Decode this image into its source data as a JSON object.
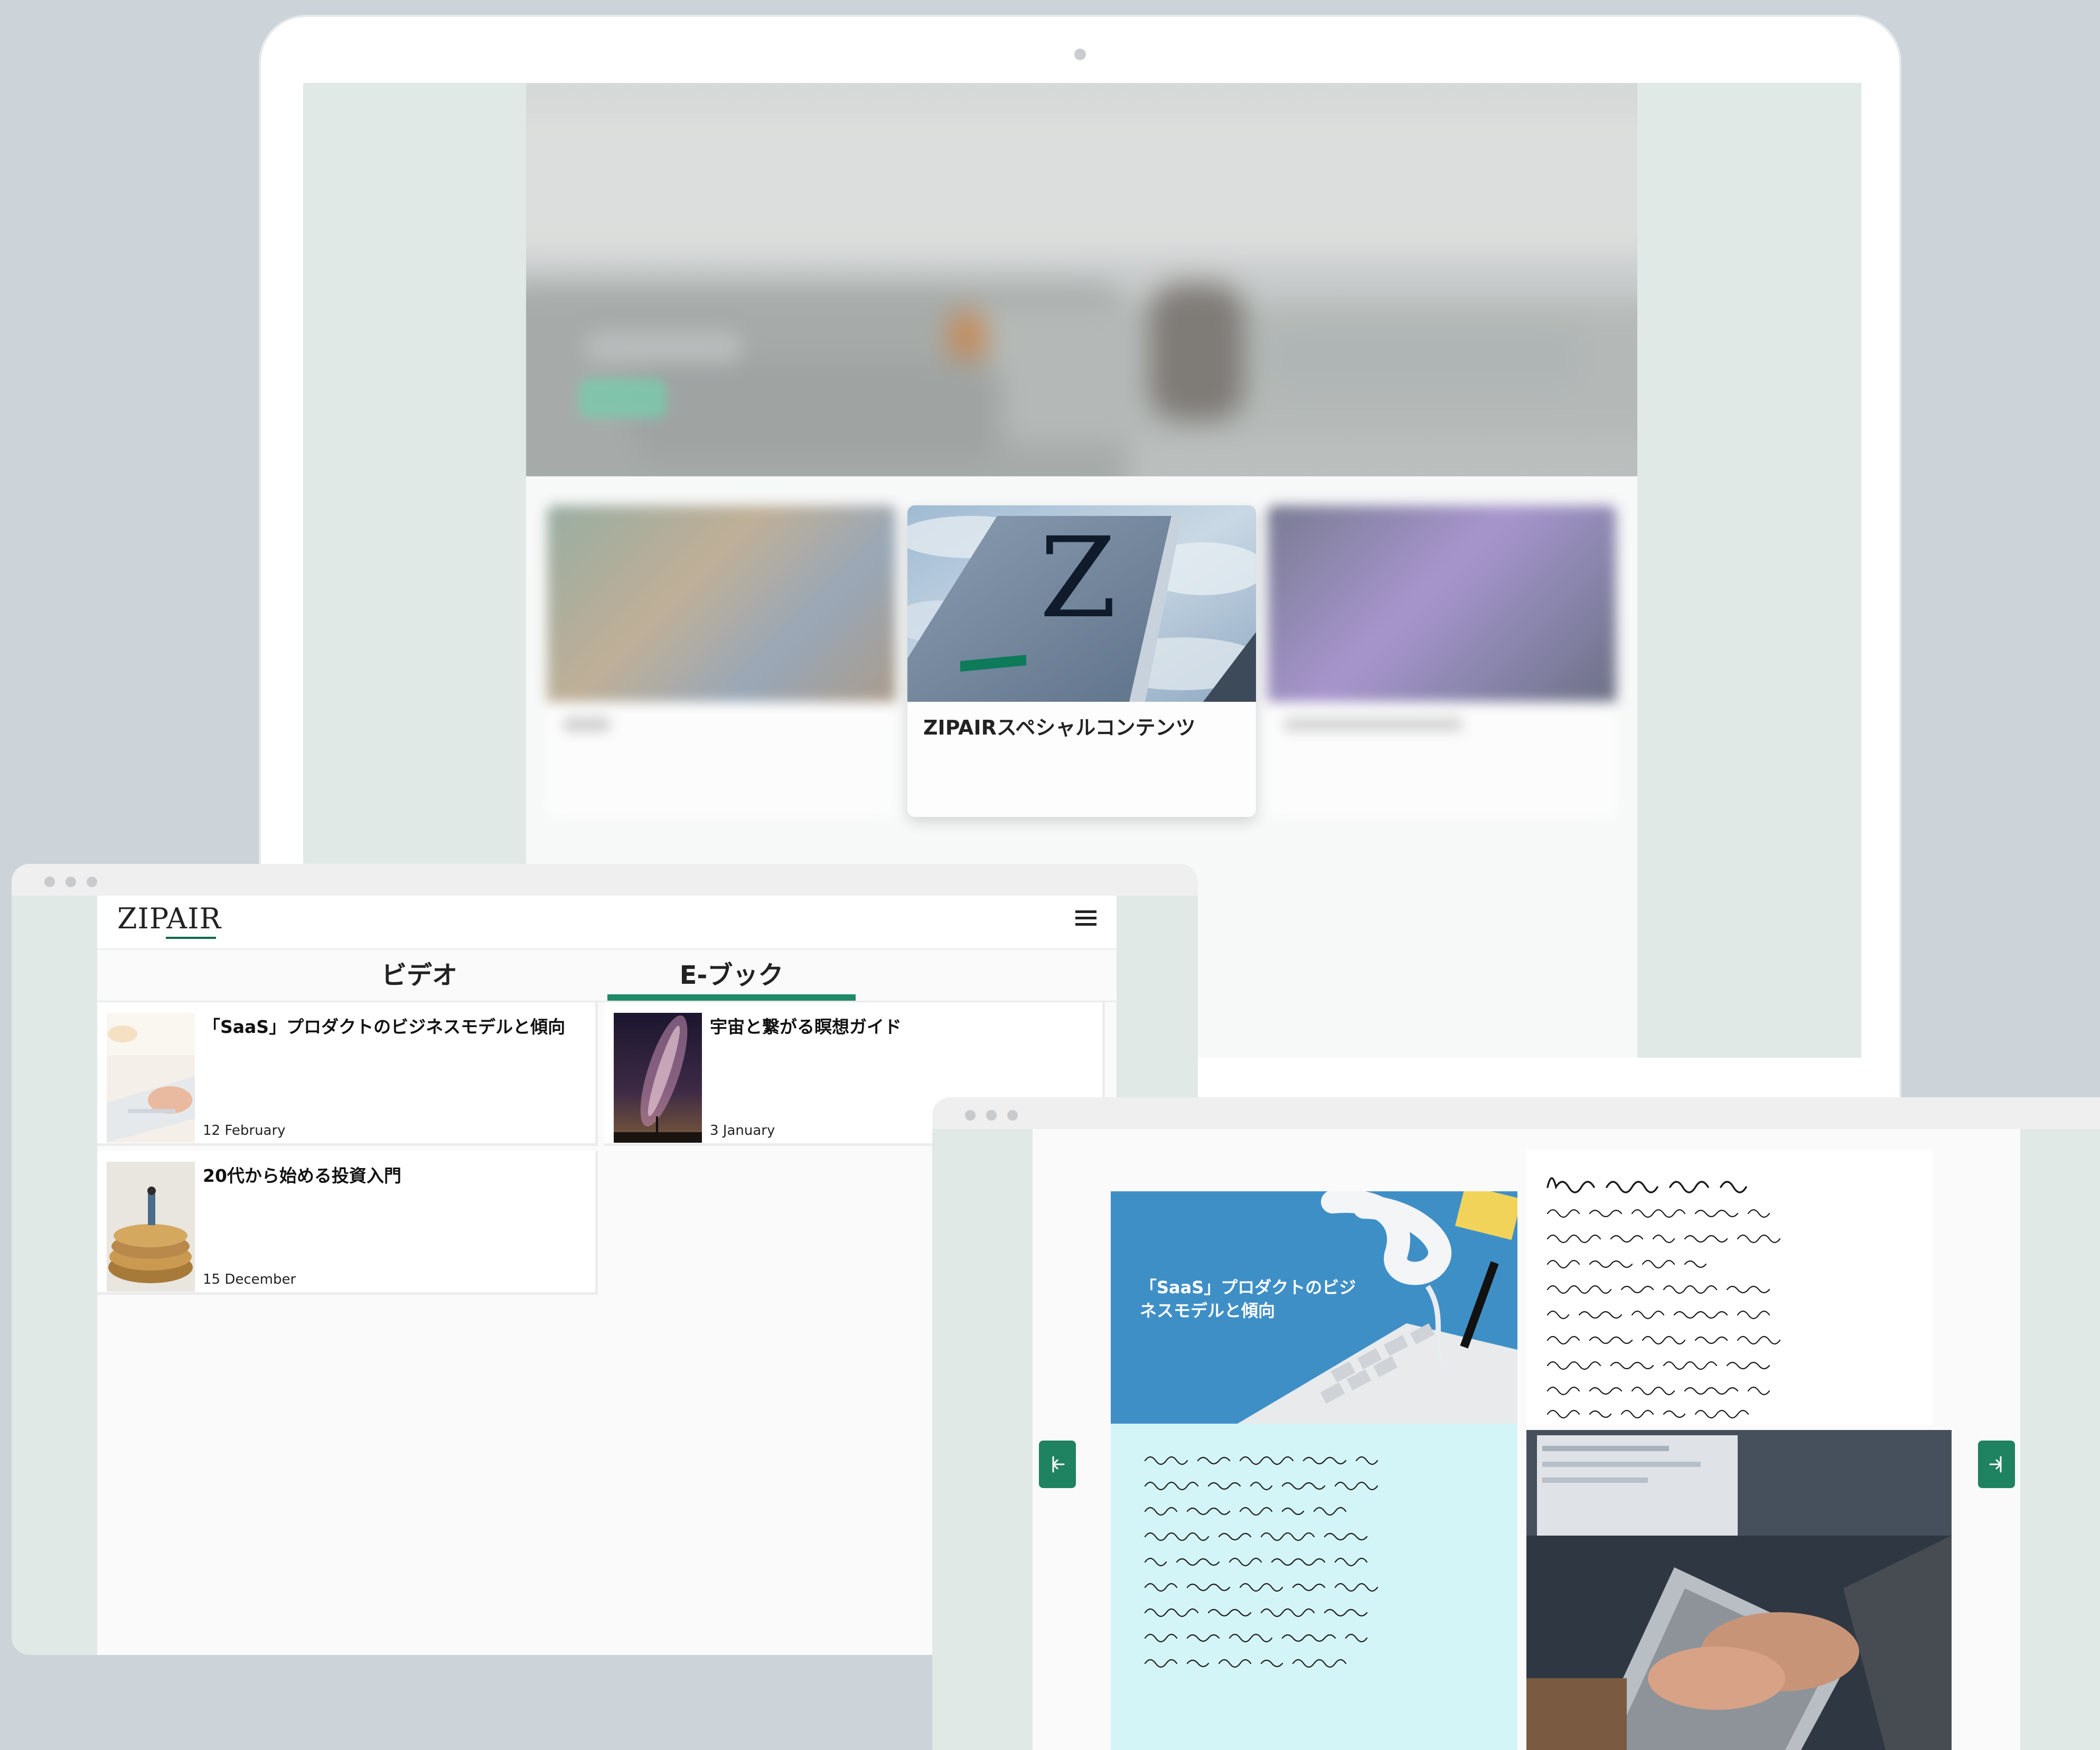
{
  "laptop": {
    "featured_card_title": "ZIPAIRスペシャルコンテンツ",
    "featured_logo_letter": "Z"
  },
  "tablet": {
    "logo": "ZIPAIR",
    "tabs": [
      {
        "label": "ビデオ",
        "active": false
      },
      {
        "label": "E-ブック",
        "active": true
      }
    ],
    "items": [
      {
        "title": "「SaaS」プロダクトのビジネスモデルと傾向",
        "date": "12 February"
      },
      {
        "title": "宇宙と繋がる瞑想ガイド",
        "date": "3 January"
      },
      {
        "title": "20代から始める投資入門",
        "date": "15 December"
      }
    ]
  },
  "ebook": {
    "cover_title": "「SaaS」プロダクトのビジネスモデルと傾向"
  },
  "colors": {
    "accent": "#1e8a68",
    "desktop_background": "#ccd4d9",
    "screen_gutter": "#e1e9e6",
    "cover_blue": "#3f8fc7",
    "page_cyan": "#d4f5f8"
  },
  "icons": {
    "menu": "hamburger-icon",
    "prev": "arrow-left-icon",
    "next": "arrow-right-icon"
  }
}
